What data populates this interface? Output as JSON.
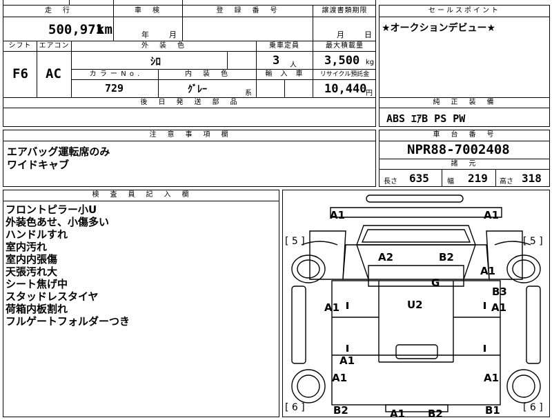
{
  "top": {
    "mileage_label": "走　行",
    "mileage_value": "500,971",
    "mileage_unit": "km",
    "inspection_label": "車　検",
    "year_unit": "年",
    "month_unit": "月",
    "registration_label": "登　録　番　号",
    "transfer_label": "譲渡書類期限",
    "transfer_month": "月",
    "transfer_day": "日",
    "shift_label": "シフト",
    "shift_value": "F6",
    "ac_label": "エアコン",
    "ac_value": "AC",
    "exterior_label": "外　装　色",
    "exterior_value": "ｼﾛ",
    "capacity_label": "乗車定員",
    "capacity_value": "3",
    "capacity_unit": "人",
    "load_label": "最大積載量",
    "load_value": "3,500",
    "load_unit": "kg",
    "color_no_label": "カ ラ ー N o .",
    "color_no_value": "729",
    "interior_label": "内　装　色",
    "interior_value": "ｸﾞﾚｰ",
    "interior_suffix": "系",
    "import_label": "輸　入　車",
    "recycle_label": "リサイクル預託金",
    "recycle_value": "10,440",
    "recycle_unit": "円",
    "aftersend_label": "後　日　発　送　部　品"
  },
  "sales": {
    "label": "セールスポイント",
    "text": "★オークションデビュー★"
  },
  "equipment": {
    "label": "純　正　装　備",
    "text": "ABS ｴｱB PS PW"
  },
  "notes": {
    "label": "注　意　事　項　欄",
    "lines": [
      "エアバッグ運転席のみ",
      "ワイドキャブ"
    ]
  },
  "chassis": {
    "label": "車　台　番　号",
    "value": "NPR88-7002408",
    "spec_label": "諸　元",
    "length_label": "長さ",
    "length_value": "635",
    "width_label": "幅",
    "width_value": "219",
    "height_label": "高さ",
    "height_value": "318"
  },
  "inspector": {
    "label": "検　査　員　記　入　欄",
    "lines": [
      "フロントピラー小U",
      "外装色あせ、小傷多い",
      "ハンドルすれ",
      "室内汚れ",
      "室内内張傷",
      "天張汚れ大",
      "シート焦げ中",
      "スタッドレスタイヤ",
      "荷箱内板割れ",
      "フルゲートフォルダーつき"
    ]
  },
  "diagram": {
    "marks": {
      "a1_fl": "A1",
      "a1_fr": "A1",
      "a2": "A2",
      "b2_cab": "B2",
      "a1_right": "A1",
      "g": "G",
      "b3": "B3",
      "a1_left_mid": "A1",
      "u2": "U2",
      "a1_right_mid": "A1",
      "a1_center": "A1",
      "a1_left_low": "A1",
      "a1_right_low": "A1",
      "b2_bl": "B2",
      "a1_bc": "A1",
      "b2_bc": "B2",
      "b1_br": "B1"
    },
    "tire_front_left": "[ 5 ]",
    "tire_front_right": "[ 5 ]",
    "tire_rear_left": "[ 6 ]",
    "tire_rear_right": "[ 6 ]"
  }
}
